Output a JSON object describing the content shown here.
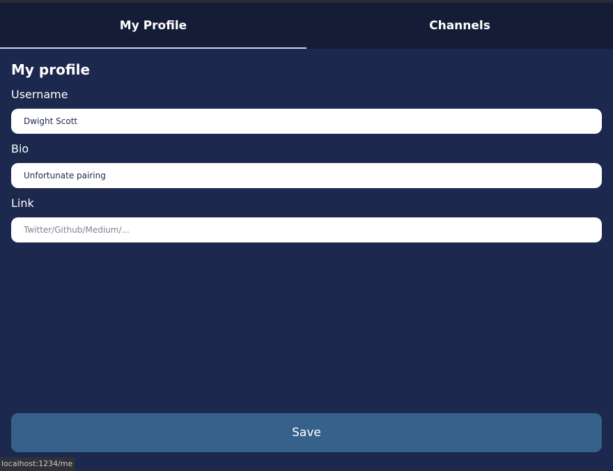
{
  "tabs": [
    {
      "label": "My Profile",
      "active": true
    },
    {
      "label": "Channels",
      "active": false
    }
  ],
  "page_title": "My profile",
  "form": {
    "username": {
      "label": "Username",
      "value": "Dwight Scott",
      "placeholder": ""
    },
    "bio": {
      "label": "Bio",
      "value": "Unfortunate pairing",
      "placeholder": ""
    },
    "link": {
      "label": "Link",
      "value": "",
      "placeholder": "Twitter/Github/Medium/..."
    }
  },
  "save_label": "Save",
  "status_url": "localhost:1234/me",
  "colors": {
    "background": "#1c284d",
    "tabbar": "#151c36",
    "save_button": "#35618a",
    "input_background": "#ffffff"
  }
}
